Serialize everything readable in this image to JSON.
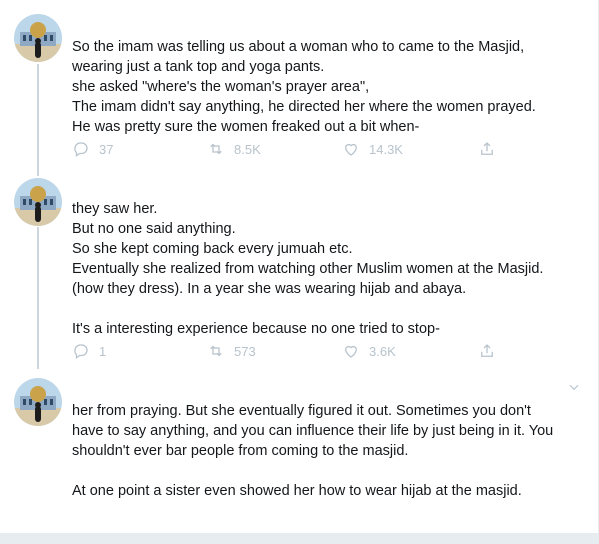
{
  "colors": {
    "text": "#14171a",
    "muted": "#b8c3cc",
    "thread": "#ccd6dd",
    "background": "#e6ecf0"
  },
  "tweets": [
    {
      "avatar_icon": "mosque-avatar-icon",
      "lines": [
        "So the imam was telling us about a woman who to came to the Masjid,",
        "wearing just a tank top and yoga pants.",
        "she asked \"where's the woman's prayer area\",",
        "The imam didn't say anything, he directed her where the women prayed.",
        "He was pretty sure the women freaked out a bit when-"
      ],
      "replies": "37",
      "retweets": "8.5K",
      "likes": "14.3K"
    },
    {
      "avatar_icon": "mosque-avatar-icon",
      "lines": [
        "they saw her.",
        "But no one said anything.",
        "So she kept coming back every jumuah etc.",
        "Eventually she realized from watching other Muslim women at the Masjid.",
        "(how they dress). In a year she was wearing hijab and abaya.",
        "",
        "It's a interesting experience because no one tried to stop-"
      ],
      "replies": "1",
      "retweets": "573",
      "likes": "3.6K"
    },
    {
      "avatar_icon": "mosque-avatar-icon",
      "lines": [
        "her from praying. But she eventually figured it out. Sometimes you don't",
        "have to say anything, and you can influence their life by just being in it. You",
        "shouldn't ever bar people from coming to the masjid.",
        "",
        "At one point a sister even showed her how to wear hijab at the masjid."
      ]
    }
  ]
}
